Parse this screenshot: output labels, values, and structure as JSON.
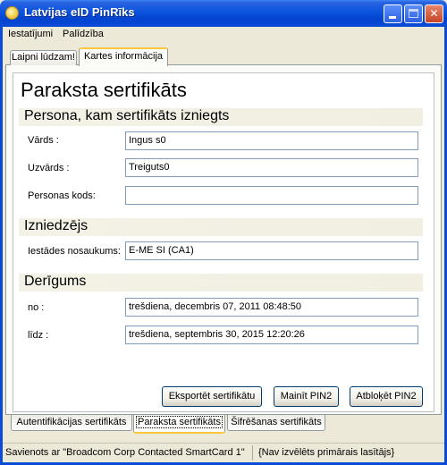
{
  "window": {
    "title": "Latvijas eID PinRīks",
    "buttons": {
      "minimize_icon": "minimize-icon",
      "maximize_icon": "maximize-icon",
      "close_icon": "close-icon",
      "close_label": "✕"
    }
  },
  "menu": [
    "Iestatījumi",
    "Palīdzība"
  ],
  "top_tabs": [
    {
      "label": "Laipni lūdzam!",
      "active": false
    },
    {
      "label": "Kartes informācija",
      "active": true
    }
  ],
  "certificate": {
    "title": "Paraksta sertifikāts",
    "subject": {
      "heading": "Persona, kam sertifikāts izniegts",
      "first_name_label": "Vārds :",
      "first_name_value": "Ingus s0",
      "last_name_label": "Uzvārds :",
      "last_name_value": "Treiguts0",
      "personal_code_label": "Personas kods:",
      "personal_code_value": ""
    },
    "issuer": {
      "heading": "Izniedzējs",
      "org_label": "Iestādes nosaukums:",
      "org_value": "E-ME SI (CA1)"
    },
    "validity": {
      "heading": "Derīgums",
      "from_label": "no :",
      "from_value": "trešdiena,  decembris  07,  2011 08:48:50",
      "to_label": "līdz :",
      "to_value": "trešdiena,  septembris  30,  2015 12:20:26"
    },
    "buttons": {
      "export": "Eksportēt sertifikātu",
      "change_pin": "Mainīt PIN2",
      "unblock_pin": "Atbloķēt PIN2"
    }
  },
  "bottom_tabs": [
    {
      "label": "Autentifikācijas sertifikāts",
      "active": false
    },
    {
      "label": "Paraksta sertifikāts",
      "active": true
    },
    {
      "label": "Šifrēšanas sertifikāts",
      "active": false
    }
  ],
  "status": {
    "connection": "Savienots ar \"Broadcom Corp Contacted SmartCard 1\"",
    "reader": "{Nav izvēlēts primārais lasītājs}"
  }
}
